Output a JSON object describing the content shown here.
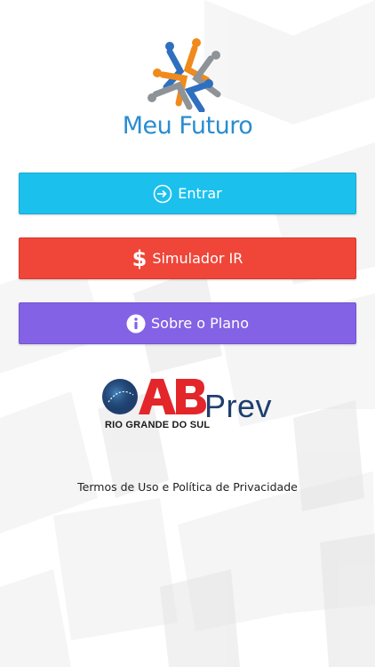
{
  "app": {
    "logo_name": "Meu Futuro"
  },
  "buttons": {
    "entrar": {
      "label": "Entrar",
      "icon": "login-icon",
      "color": "#1cc0ed"
    },
    "simulador": {
      "label": "Simulador IR",
      "icon": "dollar-icon",
      "color": "#ef4639"
    },
    "plano": {
      "label": "Sobre o Plano",
      "icon": "info-icon",
      "color": "#8462e6"
    }
  },
  "partner": {
    "logo_text": "Prev",
    "subtitle": "RIO GRANDE DO SUL"
  },
  "footer": {
    "terms_link": "Termos de Uso e Política de Privacidade"
  }
}
